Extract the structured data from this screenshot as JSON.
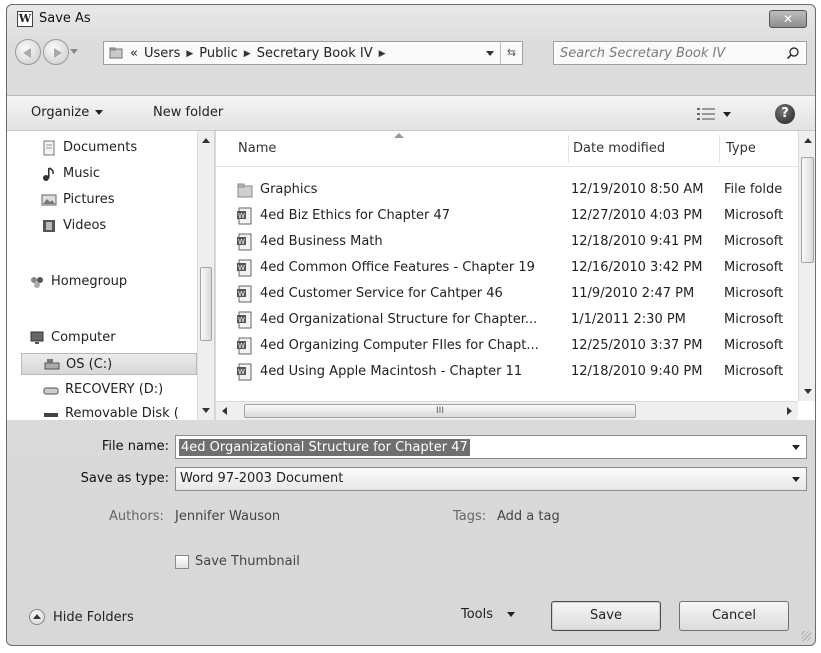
{
  "window": {
    "title": "Save As",
    "app_icon_letter": "W",
    "close_label": "✕"
  },
  "address": {
    "crumbs": [
      "«",
      "Users",
      "Public",
      "Secretary Book IV"
    ],
    "search_placeholder": "Search Secretary Book IV"
  },
  "toolbar": {
    "organize_label": "Organize",
    "new_folder_label": "New folder",
    "help_label": "?"
  },
  "nav_pane": {
    "items": [
      {
        "label": "Documents",
        "icon": "documents-icon"
      },
      {
        "label": "Music",
        "icon": "music-icon"
      },
      {
        "label": "Pictures",
        "icon": "pictures-icon"
      },
      {
        "label": "Videos",
        "icon": "videos-icon"
      },
      {
        "label": "Homegroup",
        "icon": "homegroup-icon"
      },
      {
        "label": "Computer",
        "icon": "computer-icon"
      },
      {
        "label": "OS (C:)",
        "icon": "drive-icon",
        "selected": true
      },
      {
        "label": "RECOVERY (D:)",
        "icon": "drive-icon"
      },
      {
        "label": "Removable Disk (",
        "icon": "removable-disk-icon"
      }
    ]
  },
  "file_list": {
    "columns": [
      "Name",
      "Date modified",
      "Type"
    ],
    "rows": [
      {
        "name": "Graphics",
        "date": "12/19/2010 8:50 AM",
        "type": "File folde",
        "icon": "folder-icon"
      },
      {
        "name": "4ed Biz Ethics for Chapter 47",
        "date": "12/27/2010 4:03 PM",
        "type": "Microsoft",
        "icon": "word-doc-icon"
      },
      {
        "name": "4ed Business Math",
        "date": "12/18/2010 9:41 PM",
        "type": "Microsoft",
        "icon": "word-doc-icon"
      },
      {
        "name": "4ed Common Office Features - Chapter 19",
        "date": "12/16/2010 3:42 PM",
        "type": "Microsoft",
        "icon": "word-doc-icon"
      },
      {
        "name": "4ed Customer Service for Cahtper 46",
        "date": "11/9/2010 2:47 PM",
        "type": "Microsoft",
        "icon": "word-doc-icon"
      },
      {
        "name": "4ed Organizational Structure  for Chapter...",
        "date": "1/1/2011 2:30 PM",
        "type": "Microsoft",
        "icon": "word-doc-icon"
      },
      {
        "name": "4ed Organizing Computer FIles for Chapt...",
        "date": "12/25/2010 3:37 PM",
        "type": "Microsoft",
        "icon": "word-doc-icon"
      },
      {
        "name": "4ed Using Apple Macintosh - Chapter 11",
        "date": "12/18/2010 9:40 PM",
        "type": "Microsoft",
        "icon": "word-doc-icon"
      }
    ],
    "hscroll_grip": "III"
  },
  "form": {
    "file_name_label": "File name:",
    "file_name_value": "4ed Organizational Structure  for Chapter 47",
    "save_type_label": "Save as type:",
    "save_type_value": "Word 97-2003 Document",
    "authors_label": "Authors:",
    "authors_value": "Jennifer Wauson",
    "tags_label": "Tags:",
    "tags_value": "Add a tag",
    "thumbnail_label": "Save Thumbnail",
    "thumbnail_checked": false
  },
  "footer": {
    "hide_folders_label": "Hide Folders",
    "tools_label": "Tools",
    "save_label": "Save",
    "cancel_label": "Cancel"
  }
}
